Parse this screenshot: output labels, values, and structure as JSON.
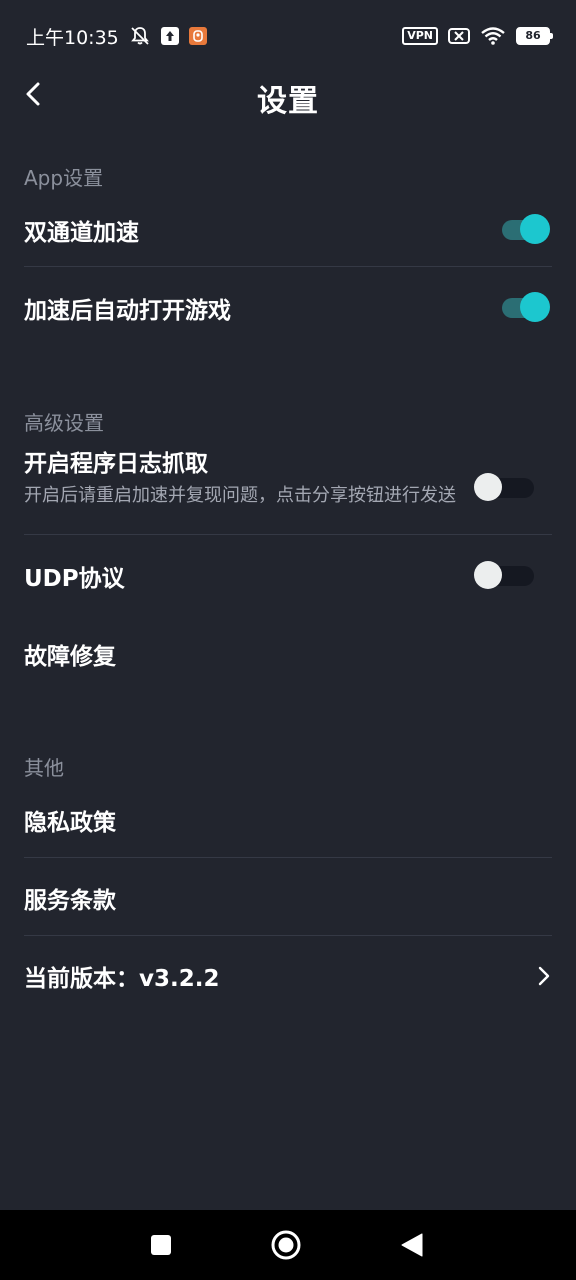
{
  "status_bar": {
    "time": "上午10:35",
    "vpn": "VPN",
    "battery": "86"
  },
  "header": {
    "title": "设置"
  },
  "sections": {
    "app": {
      "label": "App设置",
      "items": [
        {
          "title": "双通道加速",
          "toggle": true
        },
        {
          "title": "加速后自动打开游戏",
          "toggle": true
        }
      ]
    },
    "advanced": {
      "label": "高级设置",
      "items": [
        {
          "title": "开启程序日志抓取",
          "subtitle": "开启后请重启加速并复现问题，点击分享按钮进行发送",
          "toggle": false
        },
        {
          "title": "UDP协议",
          "toggle": false
        },
        {
          "title": "故障修复"
        }
      ]
    },
    "other": {
      "label": "其他",
      "items": [
        {
          "title": "隐私政策"
        },
        {
          "title": "服务条款"
        },
        {
          "title": "当前版本：v3.2.2"
        }
      ]
    }
  },
  "colors": {
    "background": "#22252e",
    "accent": "#1cc7cf",
    "label": "#8b909c"
  }
}
